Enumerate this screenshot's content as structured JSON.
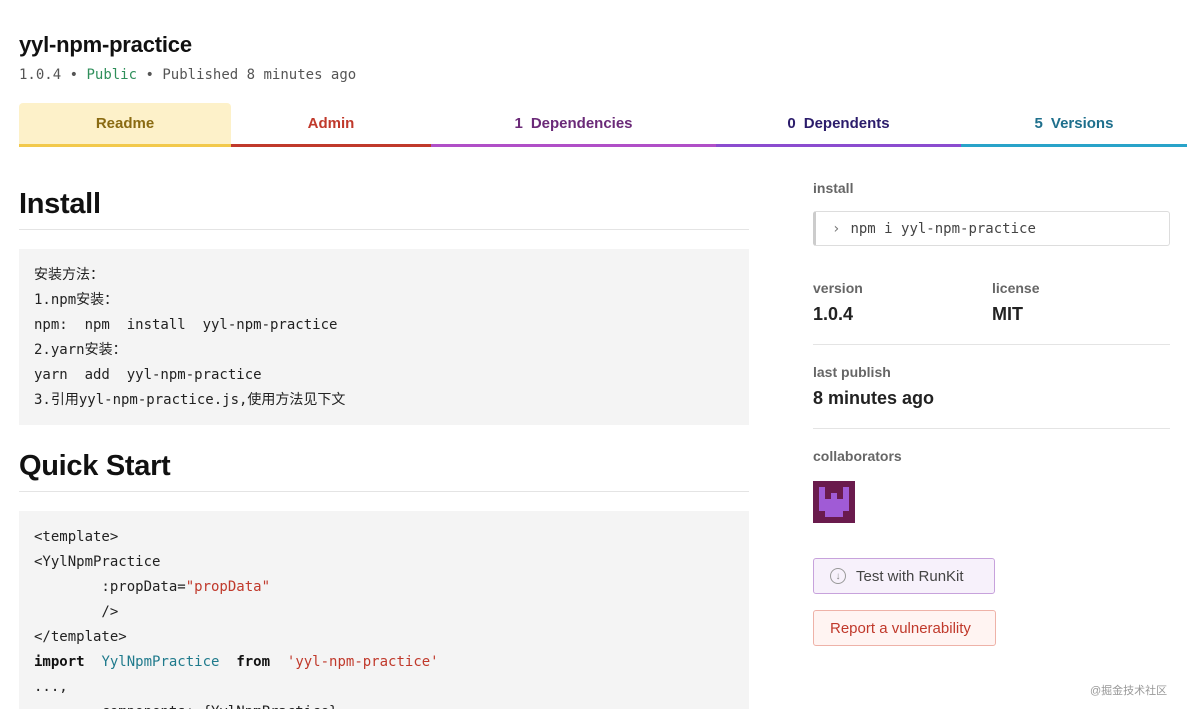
{
  "package": {
    "name": "yyl-npm-practice",
    "version": "1.0.4",
    "sep1": "•",
    "visibility": "Public",
    "sep2": "•",
    "published": "Published 8 minutes ago"
  },
  "tabs": [
    {
      "label": "Readme",
      "count": ""
    },
    {
      "label": "Admin",
      "count": ""
    },
    {
      "label": "Dependencies",
      "count": "1"
    },
    {
      "label": "Dependents",
      "count": "0"
    },
    {
      "label": "Versions",
      "count": "5"
    }
  ],
  "readme": {
    "install_heading": "Install",
    "install_lines": [
      "安装方法：",
      "1.npm安装：",
      "npm:  npm  install  yyl-npm-practice",
      "2.yarn安装：",
      "yarn  add  yyl-npm-practice",
      "3.引用yyl-npm-practice.js,使用方法见下文"
    ],
    "quickstart_heading": "Quick Start",
    "code": {
      "l1": "<template>",
      "l2": "<YylNpmPractice",
      "l3_attr": "        :propData=",
      "l3_str": "\"propData\"",
      "l4": "        />",
      "l5": "</template>",
      "l6_kw1": "import",
      "l6_cls": "YylNpmPractice",
      "l6_kw2": "from",
      "l6_str": "'yyl-npm-practice'",
      "l7": "...,",
      "l8": "        components: {YylNpmPractice},"
    }
  },
  "sidebar": {
    "install_label": "install",
    "install_cmd": "npm i yyl-npm-practice",
    "version_label": "version",
    "version_value": "1.0.4",
    "license_label": "license",
    "license_value": "MIT",
    "last_publish_label": "last publish",
    "last_publish_value": "8 minutes ago",
    "collaborators_label": "collaborators",
    "runkit_button": "Test with RunKit",
    "vuln_button": "Report a vulnerability"
  },
  "watermark": "@掘金技术社区",
  "colors": {
    "readme_tab": "#f2c94c",
    "admin_tab": "#c0392b",
    "deps_tab": "#b04fc7",
    "dependents_tab": "#8b4ccf",
    "versions_tab": "#29a3c9",
    "public": "#2f8f5b"
  }
}
